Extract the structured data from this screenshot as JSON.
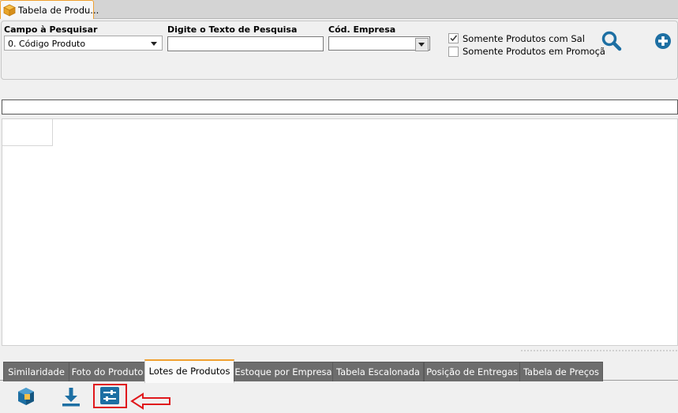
{
  "window": {
    "tab_title": "Tabela de Produ..."
  },
  "search": {
    "campo_label": "Campo à Pesquisar",
    "campo_value": "0. Código Produto",
    "texto_label": "Digite o Texto de Pesquisa",
    "texto_value": "",
    "empresa_label": "Cód. Empresa",
    "empresa_value": "",
    "options": [
      {
        "label": "Somente Produtos com Sal",
        "checked": true
      },
      {
        "label": "Somente Produtos em Promoçã",
        "checked": false
      }
    ]
  },
  "filter_bar": {
    "value": ""
  },
  "bottom_tabs": [
    {
      "label": "Similaridade",
      "active": false
    },
    {
      "label": "Foto do Produto",
      "active": false
    },
    {
      "label": "Lotes de Produtos",
      "active": true
    },
    {
      "label": "Estoque por Empresa",
      "active": false
    },
    {
      "label": "Tabela Escalonada",
      "active": false
    },
    {
      "label": "Posição de Entregas",
      "active": false
    },
    {
      "label": "Tabela de Preços",
      "active": false
    }
  ],
  "toolbar_icons": [
    "box-icon",
    "download-icon",
    "sliders-icon"
  ],
  "colors": {
    "accent_orange": "#f0a030",
    "icon_blue": "#1d6fa3",
    "highlight_red": "#e0181c"
  }
}
